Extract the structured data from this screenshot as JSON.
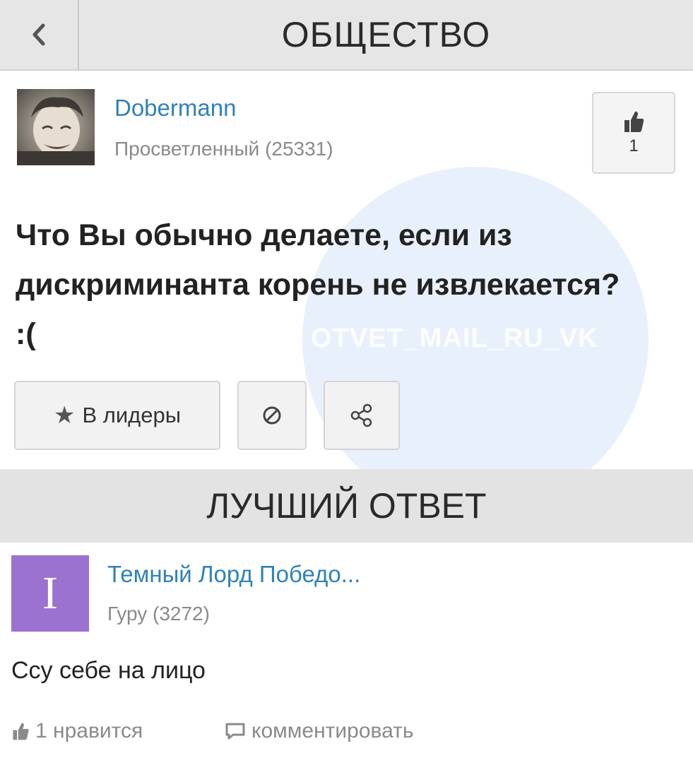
{
  "header": {
    "title": "ОБЩЕСТВО",
    "back_icon": "chevron-left-icon"
  },
  "question": {
    "author": {
      "name": "Dobermann",
      "rank": "Просветленный (25331)"
    },
    "likes": "1",
    "text": "Что Вы обычно делаете, если из дискриминанта корень не извлекается? :(",
    "actions": {
      "leader_label": "В лидеры",
      "block_icon": "block-icon",
      "share_icon": "share-icon"
    }
  },
  "watermark": "OTVET_MAIL_RU_VK",
  "best_answer": {
    "section_title": "ЛУЧШИЙ ОТВЕТ",
    "author": {
      "initial": "I",
      "name": "Темный Лорд Победо...",
      "rank": "Гуру (3272)"
    },
    "text": "Ссу себе на лицо",
    "like_label": "1 нравится",
    "comment_label": "комментировать"
  },
  "colors": {
    "link": "#2f82b8",
    "avatar_bg": "#9b72cf",
    "header_bg": "#e6e6e6",
    "muted": "#8a8a8a"
  }
}
